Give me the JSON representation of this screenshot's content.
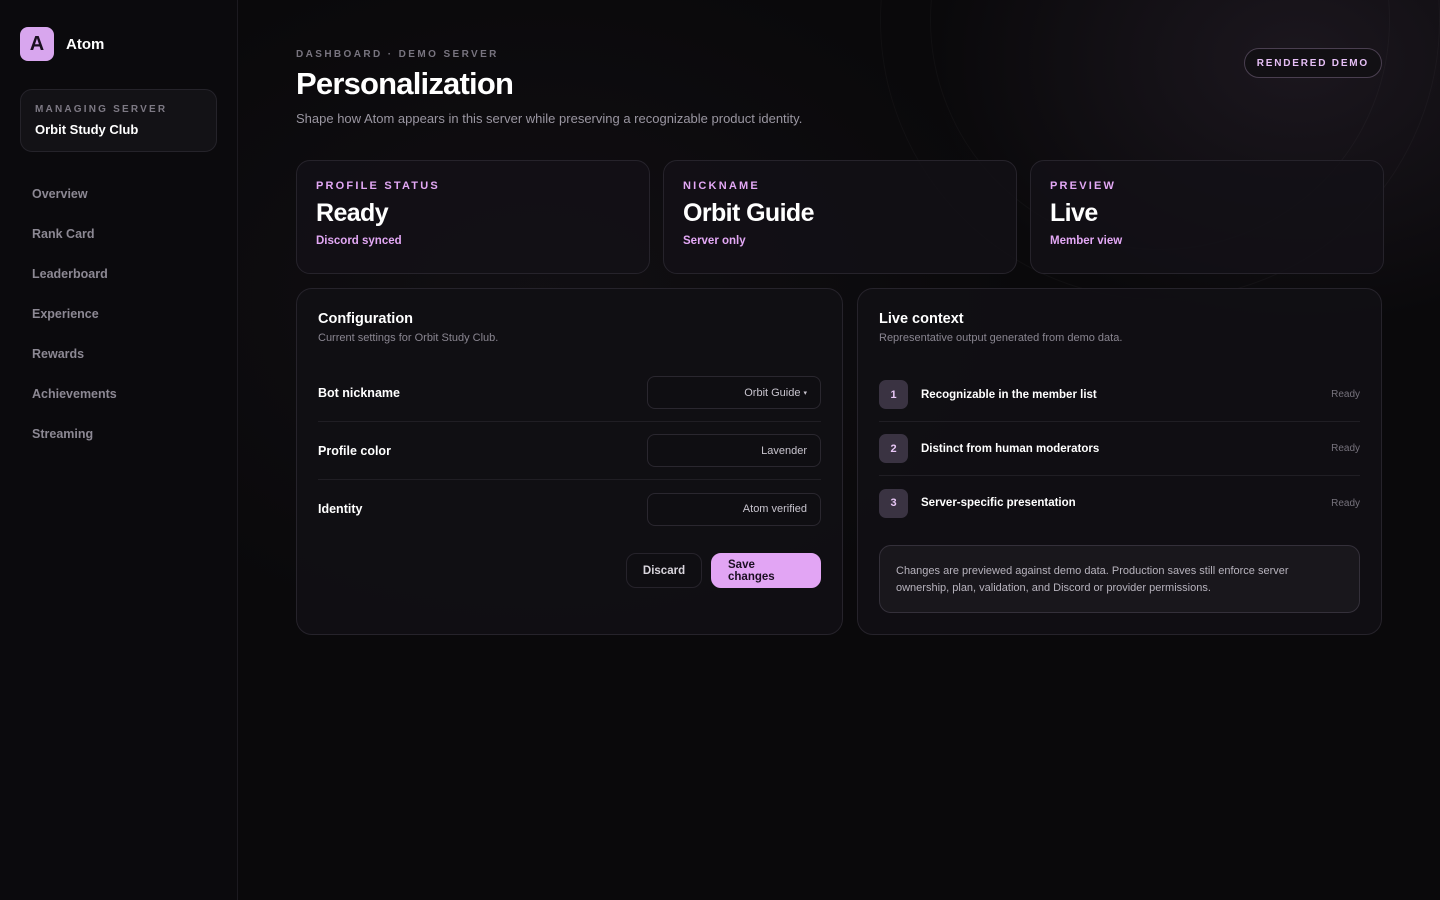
{
  "app": {
    "logo_letter": "A",
    "name": "Atom",
    "accent_color": "#e2a5f4"
  },
  "sidebar": {
    "server_label": "MANAGING SERVER",
    "server_name": "Orbit Study Club",
    "items": [
      {
        "label": "Overview"
      },
      {
        "label": "Rank Card"
      },
      {
        "label": "Leaderboard"
      },
      {
        "label": "Experience"
      },
      {
        "label": "Rewards"
      },
      {
        "label": "Achievements"
      },
      {
        "label": "Streaming"
      }
    ]
  },
  "header": {
    "eyebrow": "DASHBOARD · DEMO SERVER",
    "title": "Personalization",
    "subtitle": "Shape how Atom appears in this server while preserving a recognizable product identity.",
    "badge": "RENDERED DEMO"
  },
  "stats": [
    {
      "key": "PROFILE STATUS",
      "value": "Ready",
      "sub": "Discord synced"
    },
    {
      "key": "NICKNAME",
      "value": "Orbit Guide",
      "sub": "Server only"
    },
    {
      "key": "PREVIEW",
      "value": "Live",
      "sub": "Member view"
    }
  ],
  "configuration": {
    "title": "Configuration",
    "subtitle": "Current settings for Orbit Study Club.",
    "fields": [
      {
        "label": "Bot nickname",
        "value": "Orbit Guide",
        "caret": "▾"
      },
      {
        "label": "Profile color",
        "value": "Lavender"
      },
      {
        "label": "Identity",
        "value": "Atom verified"
      }
    ],
    "discard_label": "Discard",
    "save_label": "Save changes"
  },
  "live_context": {
    "title": "Live context",
    "subtitle": "Representative output generated from demo data.",
    "items": [
      {
        "num": "1",
        "text": "Recognizable in the member list",
        "status": "Ready"
      },
      {
        "num": "2",
        "text": "Distinct from human moderators",
        "status": "Ready"
      },
      {
        "num": "3",
        "text": "Server-specific presentation",
        "status": "Ready"
      }
    ],
    "note": "Changes are previewed against demo data. Production saves still enforce server ownership, plan, validation, and Discord or provider permissions."
  }
}
